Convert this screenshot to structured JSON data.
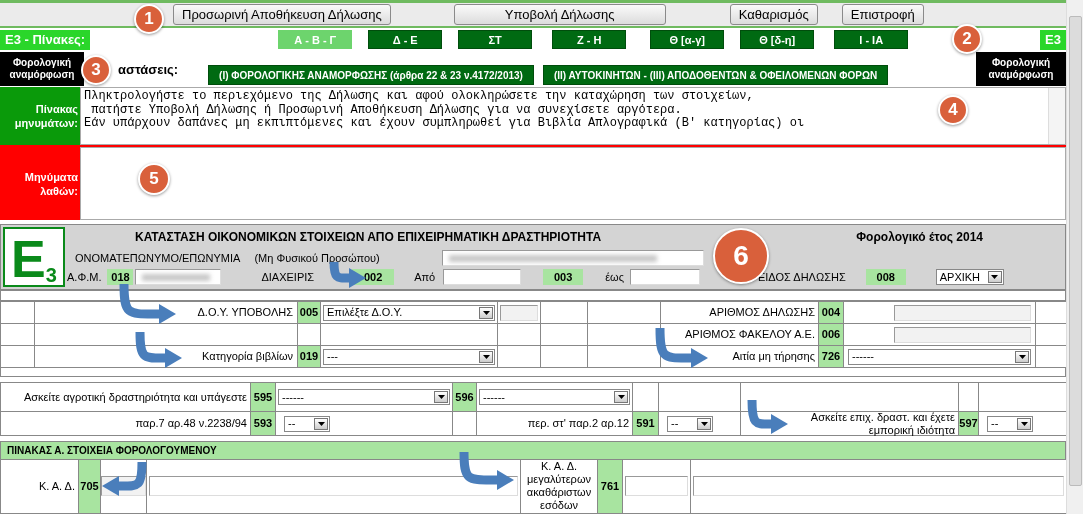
{
  "toolbar": {
    "buttons": [
      "Προσωρινή Αποθήκευση Δήλωσης",
      "Υποβολή Δήλωσης",
      "Καθαρισμός",
      "Επιστροφή"
    ]
  },
  "tables_bar": {
    "label": "Ε3 - Πίνακες:",
    "right_label": "Ε3",
    "tabs": [
      {
        "label": "Α - Β - Γ",
        "selected": true
      },
      {
        "label": "Δ - Ε",
        "selected": false
      },
      {
        "label": "ΣΤ",
        "selected": false
      },
      {
        "label": "Ζ - Η",
        "selected": false
      },
      {
        "label": "Θ [α-γ]",
        "selected": false
      },
      {
        "label": "Θ [δ-η]",
        "selected": false
      },
      {
        "label": "Ι - ΙΑ",
        "selected": false
      }
    ]
  },
  "statements_bar": {
    "left_label": "Φορολογική αναμόρφωση",
    "label": "αστάσεις:",
    "right_label": "Φορολογική αναμόρφωση",
    "buttons": [
      "(Ι) ΦΟΡΟΛΟΓΙΚΗΣ ΑΝΑΜΟΡΦΩΣΗΣ (άρθρα 22 & 23 ν.4172/2013)",
      "(ΙΙ) ΑΥΤΟΚΙΝΗΤΩΝ - (ΙΙΙ) ΑΠΟΔΟΘΕΝΤΩΝ & ΟΦΕΙΛΟΜΕΝΩΝ ΦΟΡΩΝ"
    ]
  },
  "messages": {
    "label": "Πίνακας μηνυμάτων:",
    "lines": [
      "Πληκτρολογήστε το περιεχόμενο της Δήλωσης και αφού ολοκληρώσετε την καταχώρηση των στοιχείων,",
      " πατήστε Υποβολή Δήλωσης ή Προσωρινή Αποθήκευση Δήλωσης για να συνεχίσετε αργότερα.",
      "Εάν υπάρχουν δαπάνες μη εκπιπτόμενες και έχουν συμπληρωθεί για Βιβλία Απλογραφικά (Β' κατηγορίας) οι"
    ]
  },
  "errors": {
    "label": "Μηνύματα λαθών:"
  },
  "form": {
    "logo": "Ε",
    "logo_sub": "3",
    "title": "ΚΑΤΑΣΤΑΣΗ ΟΙΚΟΝΟΜΙΚΩΝ ΣΤΟΙΧΕΙΩΝ ΑΠΟ ΕΠΙΧΕΙΡΗΜΑΤΙΚΗ ΔΡΑΣΤΗΡΙΟΤΗΤΑ",
    "tax_year": "Φορολογικό έτος 2014",
    "name_label": "ΟΝΟΜΑΤΕΠΩΝΥΜΟ/ΕΠΩΝΥΜΙΑ",
    "name_note": "(Μη Φυσικού Προσώπου)",
    "afm_label": "Α.Φ.Μ.",
    "afm_code": "018",
    "management_label": "ΔΙΑΧΕΙΡΙΣ",
    "management_code": "002",
    "from_label": "Από",
    "from_code": "003",
    "to_label": "έως",
    "type_label": "ΕΙΔΟΣ ΔΗΛΩΣΗΣ",
    "type_code": "008",
    "type_value": "ΑΡΧΙΚΗ"
  },
  "details": {
    "rows": [
      {
        "label": "Δ.Ο.Υ. ΥΠΟΒΟΛΗΣ",
        "code": "005",
        "select": "Επιλέξτε Δ.Ο.Υ.",
        "right_label": "ΑΡΙΘΜΟΣ ΔΗΛΩΣΗΣ",
        "right_code": "004"
      },
      {
        "right_label": "ΑΡΙΘΜΟΣ ΦΑΚΕΛΟΥ Α.Ε.",
        "right_code": "006"
      },
      {
        "label": "Κατηγορία βιβλίων",
        "code": "019",
        "select": "---",
        "right_label": "Αιτία μη τήρησης",
        "right_code": "726",
        "right_select": "------"
      }
    ]
  },
  "activity": {
    "rows": [
      [
        {
          "kind": "label",
          "text": "Ασκείτε αγροτική δραστηριότητα και υπάγεστε"
        },
        {
          "kind": "code",
          "text": "595"
        },
        {
          "kind": "select",
          "value": "------"
        },
        {
          "kind": "code",
          "text": "596"
        },
        {
          "kind": "select",
          "value": "------"
        },
        {
          "kind": "empty"
        },
        {
          "kind": "empty"
        },
        {
          "kind": "empty"
        },
        {
          "kind": "empty"
        },
        {
          "kind": "empty"
        }
      ],
      [
        {
          "kind": "label",
          "text": "παρ.7 αρ.48 ν.2238/94"
        },
        {
          "kind": "code",
          "text": "593"
        },
        {
          "kind": "small_select",
          "value": "--"
        },
        {
          "kind": "empty"
        },
        {
          "kind": "label",
          "text": "περ. στ' παρ.2 αρ.12"
        },
        {
          "kind": "code",
          "text": "591"
        },
        {
          "kind": "small_select",
          "value": "--"
        },
        {
          "kind": "label",
          "text": "Ασκείτε επιχ. δραστ. και έχετε εμπορική ιδιότητα"
        },
        {
          "kind": "code",
          "text": "597"
        },
        {
          "kind": "small_select",
          "value": "--"
        }
      ]
    ]
  },
  "table_a": {
    "title": "ΠΙΝΑΚΑΣ Α. ΣΤΟΙΧΕΙΑ ΦΟΡΟΛΟΓΟΥΜΕΝΟΥ",
    "cells": [
      {
        "kind": "label",
        "text": "Κ. Α. Δ."
      },
      {
        "kind": "code",
        "text": "705"
      },
      {
        "kind": "grey_input"
      },
      {
        "kind": "input"
      },
      {
        "kind": "center_label",
        "text": "Κ. Α. Δ. μεγαλύτερων ακαθάριστων εσόδων"
      },
      {
        "kind": "code",
        "text": "761"
      },
      {
        "kind": "input"
      },
      {
        "kind": "input"
      }
    ]
  },
  "callouts": [
    "1",
    "2",
    "3",
    "4",
    "5",
    "6"
  ]
}
